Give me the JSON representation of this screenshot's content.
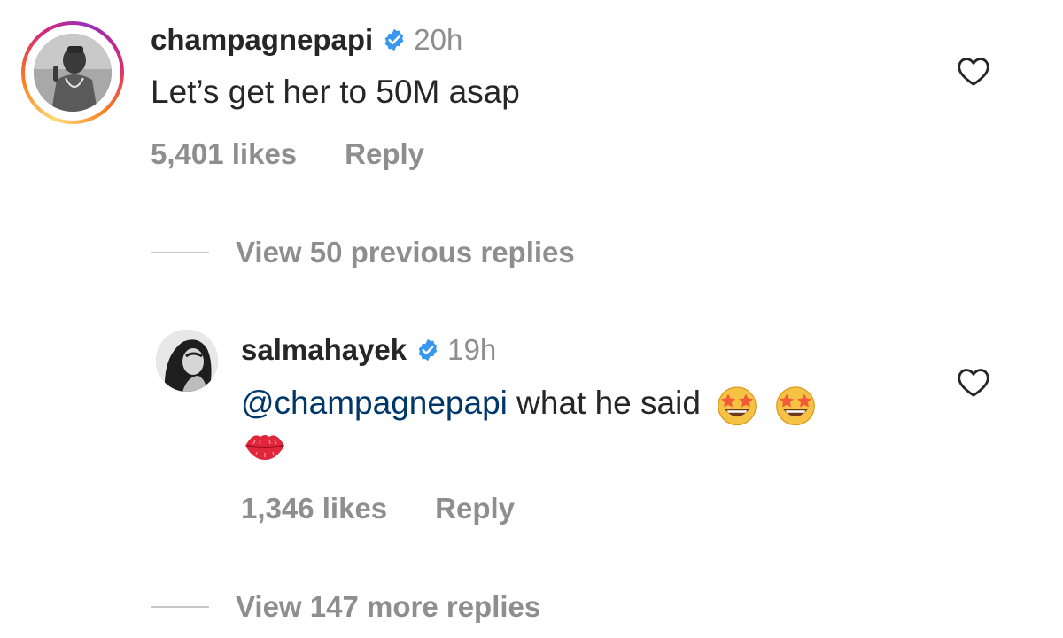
{
  "comments": [
    {
      "username": "champagnepapi",
      "verified": true,
      "time": "20h",
      "text": "Let’s get her to 50M asap",
      "likes": "5,401 likes",
      "reply_label": "Reply",
      "avatar": "profile-photo",
      "has_story_ring": true
    },
    {
      "username": "salmahayek",
      "verified": true,
      "time": "19h",
      "mention": "@champagnepapi",
      "text": " what he said",
      "emojis": [
        "star-struck-emoji",
        "star-struck-emoji",
        "kiss-mark-emoji"
      ],
      "likes": "1,346 likes",
      "reply_label": "Reply",
      "avatar": "profile-photo"
    }
  ],
  "thread": {
    "view_previous": "View 50 previous replies",
    "view_more": "View 147 more replies"
  },
  "icons": {
    "verified": "verified-badge-icon",
    "like": "heart-outline-icon"
  },
  "colors": {
    "text": "#262626",
    "secondary": "#8e8e8e",
    "mention": "#00376b",
    "verified": "#3897f0"
  }
}
